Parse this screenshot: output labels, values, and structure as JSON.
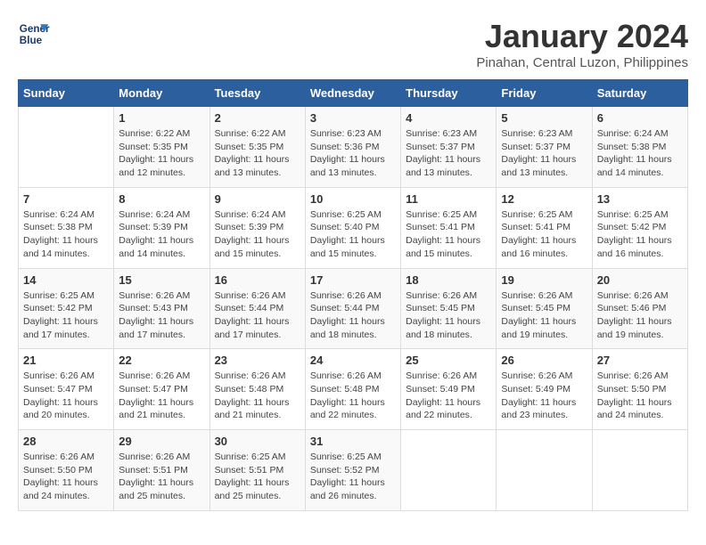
{
  "logo": {
    "line1": "General",
    "line2": "Blue"
  },
  "title": "January 2024",
  "subtitle": "Pinahan, Central Luzon, Philippines",
  "days_of_week": [
    "Sunday",
    "Monday",
    "Tuesday",
    "Wednesday",
    "Thursday",
    "Friday",
    "Saturday"
  ],
  "weeks": [
    [
      {
        "day": "",
        "info": ""
      },
      {
        "day": "1",
        "info": "Sunrise: 6:22 AM\nSunset: 5:35 PM\nDaylight: 11 hours\nand 12 minutes."
      },
      {
        "day": "2",
        "info": "Sunrise: 6:22 AM\nSunset: 5:35 PM\nDaylight: 11 hours\nand 13 minutes."
      },
      {
        "day": "3",
        "info": "Sunrise: 6:23 AM\nSunset: 5:36 PM\nDaylight: 11 hours\nand 13 minutes."
      },
      {
        "day": "4",
        "info": "Sunrise: 6:23 AM\nSunset: 5:37 PM\nDaylight: 11 hours\nand 13 minutes."
      },
      {
        "day": "5",
        "info": "Sunrise: 6:23 AM\nSunset: 5:37 PM\nDaylight: 11 hours\nand 13 minutes."
      },
      {
        "day": "6",
        "info": "Sunrise: 6:24 AM\nSunset: 5:38 PM\nDaylight: 11 hours\nand 14 minutes."
      }
    ],
    [
      {
        "day": "7",
        "info": "Sunrise: 6:24 AM\nSunset: 5:38 PM\nDaylight: 11 hours\nand 14 minutes."
      },
      {
        "day": "8",
        "info": "Sunrise: 6:24 AM\nSunset: 5:39 PM\nDaylight: 11 hours\nand 14 minutes."
      },
      {
        "day": "9",
        "info": "Sunrise: 6:24 AM\nSunset: 5:39 PM\nDaylight: 11 hours\nand 15 minutes."
      },
      {
        "day": "10",
        "info": "Sunrise: 6:25 AM\nSunset: 5:40 PM\nDaylight: 11 hours\nand 15 minutes."
      },
      {
        "day": "11",
        "info": "Sunrise: 6:25 AM\nSunset: 5:41 PM\nDaylight: 11 hours\nand 15 minutes."
      },
      {
        "day": "12",
        "info": "Sunrise: 6:25 AM\nSunset: 5:41 PM\nDaylight: 11 hours\nand 16 minutes."
      },
      {
        "day": "13",
        "info": "Sunrise: 6:25 AM\nSunset: 5:42 PM\nDaylight: 11 hours\nand 16 minutes."
      }
    ],
    [
      {
        "day": "14",
        "info": "Sunrise: 6:25 AM\nSunset: 5:42 PM\nDaylight: 11 hours\nand 17 minutes."
      },
      {
        "day": "15",
        "info": "Sunrise: 6:26 AM\nSunset: 5:43 PM\nDaylight: 11 hours\nand 17 minutes."
      },
      {
        "day": "16",
        "info": "Sunrise: 6:26 AM\nSunset: 5:44 PM\nDaylight: 11 hours\nand 17 minutes."
      },
      {
        "day": "17",
        "info": "Sunrise: 6:26 AM\nSunset: 5:44 PM\nDaylight: 11 hours\nand 18 minutes."
      },
      {
        "day": "18",
        "info": "Sunrise: 6:26 AM\nSunset: 5:45 PM\nDaylight: 11 hours\nand 18 minutes."
      },
      {
        "day": "19",
        "info": "Sunrise: 6:26 AM\nSunset: 5:45 PM\nDaylight: 11 hours\nand 19 minutes."
      },
      {
        "day": "20",
        "info": "Sunrise: 6:26 AM\nSunset: 5:46 PM\nDaylight: 11 hours\nand 19 minutes."
      }
    ],
    [
      {
        "day": "21",
        "info": "Sunrise: 6:26 AM\nSunset: 5:47 PM\nDaylight: 11 hours\nand 20 minutes."
      },
      {
        "day": "22",
        "info": "Sunrise: 6:26 AM\nSunset: 5:47 PM\nDaylight: 11 hours\nand 21 minutes."
      },
      {
        "day": "23",
        "info": "Sunrise: 6:26 AM\nSunset: 5:48 PM\nDaylight: 11 hours\nand 21 minutes."
      },
      {
        "day": "24",
        "info": "Sunrise: 6:26 AM\nSunset: 5:48 PM\nDaylight: 11 hours\nand 22 minutes."
      },
      {
        "day": "25",
        "info": "Sunrise: 6:26 AM\nSunset: 5:49 PM\nDaylight: 11 hours\nand 22 minutes."
      },
      {
        "day": "26",
        "info": "Sunrise: 6:26 AM\nSunset: 5:49 PM\nDaylight: 11 hours\nand 23 minutes."
      },
      {
        "day": "27",
        "info": "Sunrise: 6:26 AM\nSunset: 5:50 PM\nDaylight: 11 hours\nand 24 minutes."
      }
    ],
    [
      {
        "day": "28",
        "info": "Sunrise: 6:26 AM\nSunset: 5:50 PM\nDaylight: 11 hours\nand 24 minutes."
      },
      {
        "day": "29",
        "info": "Sunrise: 6:26 AM\nSunset: 5:51 PM\nDaylight: 11 hours\nand 25 minutes."
      },
      {
        "day": "30",
        "info": "Sunrise: 6:25 AM\nSunset: 5:51 PM\nDaylight: 11 hours\nand 25 minutes."
      },
      {
        "day": "31",
        "info": "Sunrise: 6:25 AM\nSunset: 5:52 PM\nDaylight: 11 hours\nand 26 minutes."
      },
      {
        "day": "",
        "info": ""
      },
      {
        "day": "",
        "info": ""
      },
      {
        "day": "",
        "info": ""
      }
    ]
  ]
}
